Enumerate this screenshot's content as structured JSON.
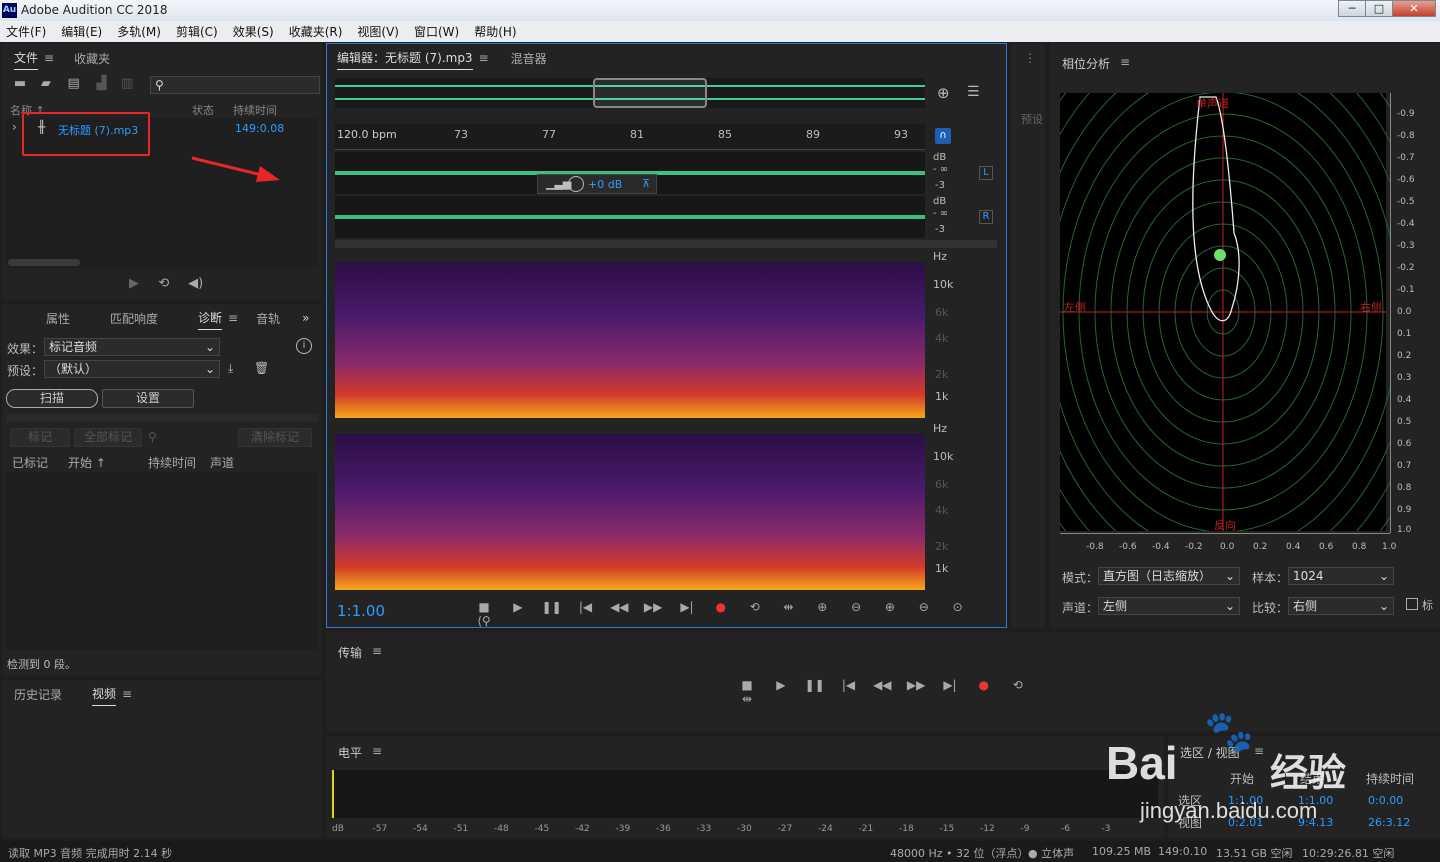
{
  "window": {
    "title": "Adobe Audition CC 2018",
    "logo": "Au",
    "controls": [
      "─",
      "□",
      "✕"
    ]
  },
  "menu": [
    "文件(F)",
    "编辑(E)",
    "多轨(M)",
    "剪辑(C)",
    "效果(S)",
    "收藏夹(R)",
    "视图(V)",
    "窗口(W)",
    "帮助(H)"
  ],
  "files_panel": {
    "tabs": [
      "文件",
      "收藏夹"
    ],
    "columns": {
      "name": "名称 ↑",
      "status": "状态",
      "duration": "持续时间"
    },
    "file": {
      "name": "无标题 (7).mp3",
      "duration": "149:0.08"
    }
  },
  "diag_panel": {
    "tabs": [
      "属性",
      "匹配响度",
      "诊断",
      "音轨"
    ],
    "effect_label": "效果：",
    "effect_value": "标记音频",
    "preset_label": "预设：",
    "preset_value": "（默认）",
    "scan_btn": "扫描",
    "settings_btn": "设置",
    "mark_btn": "标记",
    "mark_all_btn": "全部标记",
    "clear_btn": "清除标记",
    "cols": [
      "已标记",
      "开始 ↑",
      "持续时间",
      "声道"
    ],
    "detected": "检测到 0 段。"
  },
  "history_panel": {
    "tabs": [
      "历史记录",
      "视频"
    ]
  },
  "editor": {
    "tab_label": "编辑器：无标题 (7).mp3",
    "mixer_label": "混音器",
    "bpm": "120.0 bpm",
    "ruler_ticks": [
      "73",
      "77",
      "81",
      "85",
      "89",
      "93"
    ],
    "db_label": "dB",
    "db_inf": "- ∞",
    "db_m3": "-3",
    "ch_left": "L",
    "ch_right": "R",
    "hud_gain": "+0 dB",
    "hz_label": "Hz",
    "hz_ticks": [
      "10k",
      "6k",
      "4k",
      "2k",
      "1k"
    ],
    "time": "1:1.00"
  },
  "preset_side": "预设",
  "phase_panel": {
    "title": "相位分析",
    "top_label": "单声道",
    "left_label": "左侧",
    "right_label": "右侧",
    "bottom_label": "反向",
    "y_ticks": [
      "-0.9",
      "-0.8",
      "-0.7",
      "-0.6",
      "-0.5",
      "-0.4",
      "-0.3",
      "-0.2",
      "-0.1",
      "0.0",
      "0.1",
      "0.2",
      "0.3",
      "0.4",
      "0.5",
      "0.6",
      "0.7",
      "0.8",
      "0.9",
      "1.0"
    ],
    "x_ticks": [
      "-0.8",
      "-0.6",
      "-0.4",
      "-0.2",
      "0.0",
      "0.2",
      "0.4",
      "0.6",
      "0.8",
      "1.0"
    ],
    "mode_label": "模式：",
    "mode_value": "直方图（日志缩放）",
    "sample_label": "样本：",
    "sample_value": "1024",
    "channel_label": "声道：",
    "channel_value": "左侧",
    "compare_label": "比较：",
    "compare_value": "右侧",
    "checkbox_label": "标"
  },
  "transport_panel": {
    "title": "传输"
  },
  "level_panel": {
    "title": "电平",
    "scale": [
      "dB",
      "-57",
      "-54",
      "-51",
      "-48",
      "-45",
      "-42",
      "-39",
      "-36",
      "-33",
      "-30",
      "-27",
      "-24",
      "-21",
      "-18",
      "-15",
      "-12",
      "-9",
      "-6",
      "-3"
    ]
  },
  "selection_panel": {
    "title": "选区 / 视图",
    "headers": [
      "开始",
      "结束",
      "持续时间"
    ],
    "row_selection": {
      "label": "选区",
      "start": "1:1.00",
      "end": "1:1.00",
      "duration": "0:0.00"
    },
    "row_view": {
      "label": "视图",
      "start": "0:2.01",
      "end": "9:4.13",
      "duration": "26:3.12"
    }
  },
  "watermark": {
    "brand": "Bai",
    "brand_cn": "经验",
    "url": "jingyan.baidu.com"
  },
  "statusbar": {
    "message": "读取 MP3 音频 完成用时 2.14 秒",
    "format": "48000 Hz • 32 位（浮点）",
    "channels": "● 立体声",
    "size": "109.25 MB",
    "duration": "149:0.10",
    "free": "13.51 GB 空闲",
    "time_free": "10:29:26.81 空闲"
  },
  "colors": {
    "accent": "#2e9bff",
    "wave": "#3fd190",
    "record": "#e83434",
    "annotation": "#e8262a"
  }
}
